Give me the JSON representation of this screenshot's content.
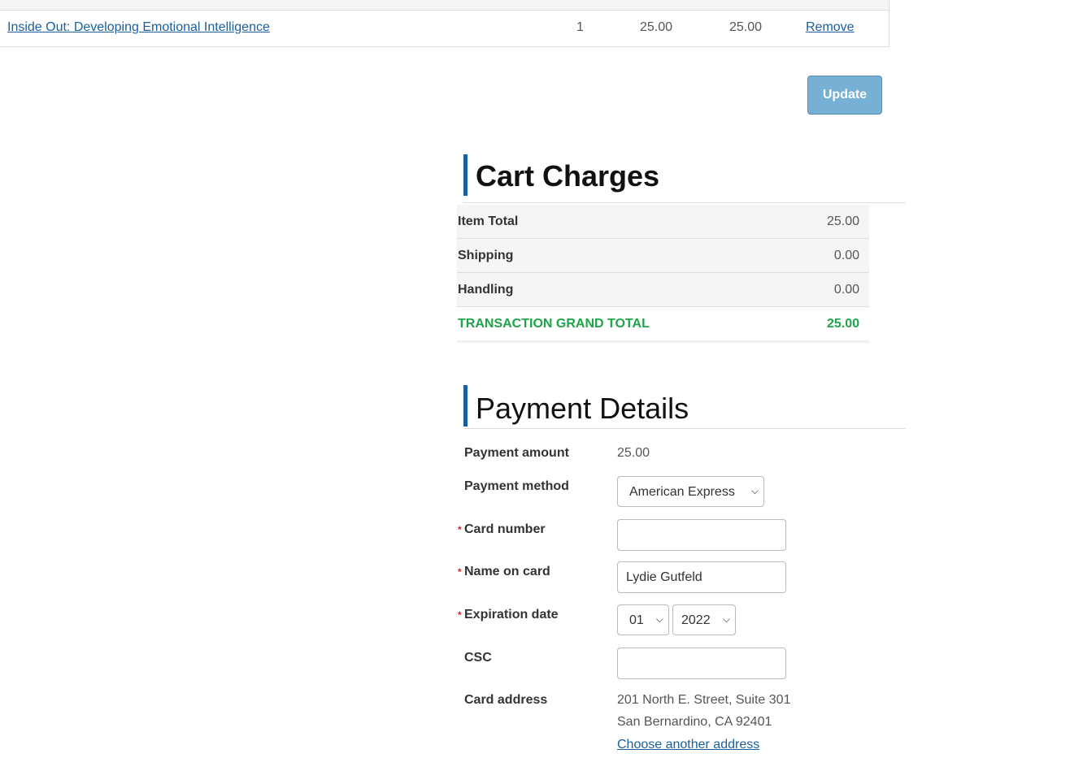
{
  "cart": {
    "rows": [
      {
        "title": "Inside Out: Developing Emotional Intelligence",
        "qty": "1",
        "price": "25.00",
        "total": "25.00",
        "remove": "Remove"
      }
    ],
    "update_label": "Update"
  },
  "charges": {
    "heading": "Cart Charges",
    "item_total_label": "Item Total",
    "item_total_value": "25.00",
    "shipping_label": "Shipping",
    "shipping_value": "0.00",
    "handling_label": "Handling",
    "handling_value": "0.00",
    "grand_label": "TRANSACTION GRAND TOTAL",
    "grand_value": "25.00"
  },
  "payment": {
    "heading": "Payment Details",
    "amount_label": "Payment amount",
    "amount_value": "25.00",
    "method_label": "Payment method",
    "method_value": "American Express",
    "card_number_label": "Card number",
    "card_number_value": "",
    "name_label": "Name on card",
    "name_value": "Lydie Gutfeld",
    "expiration_label": "Expiration date",
    "exp_month": "01",
    "exp_year": "2022",
    "csc_label": "CSC",
    "csc_value": "",
    "address_label": "Card address",
    "address_line1": "201 North E. Street, Suite 301",
    "address_line2": "San Bernardino, CA 92401",
    "choose_address": "Choose another address",
    "required_mark": "*"
  },
  "colors": {
    "link": "#1a5f9e",
    "accent_bar": "#1a5f9e",
    "grand_total": "#1fa44a",
    "required": "#d9232d",
    "update_button": "#76b0d5"
  }
}
